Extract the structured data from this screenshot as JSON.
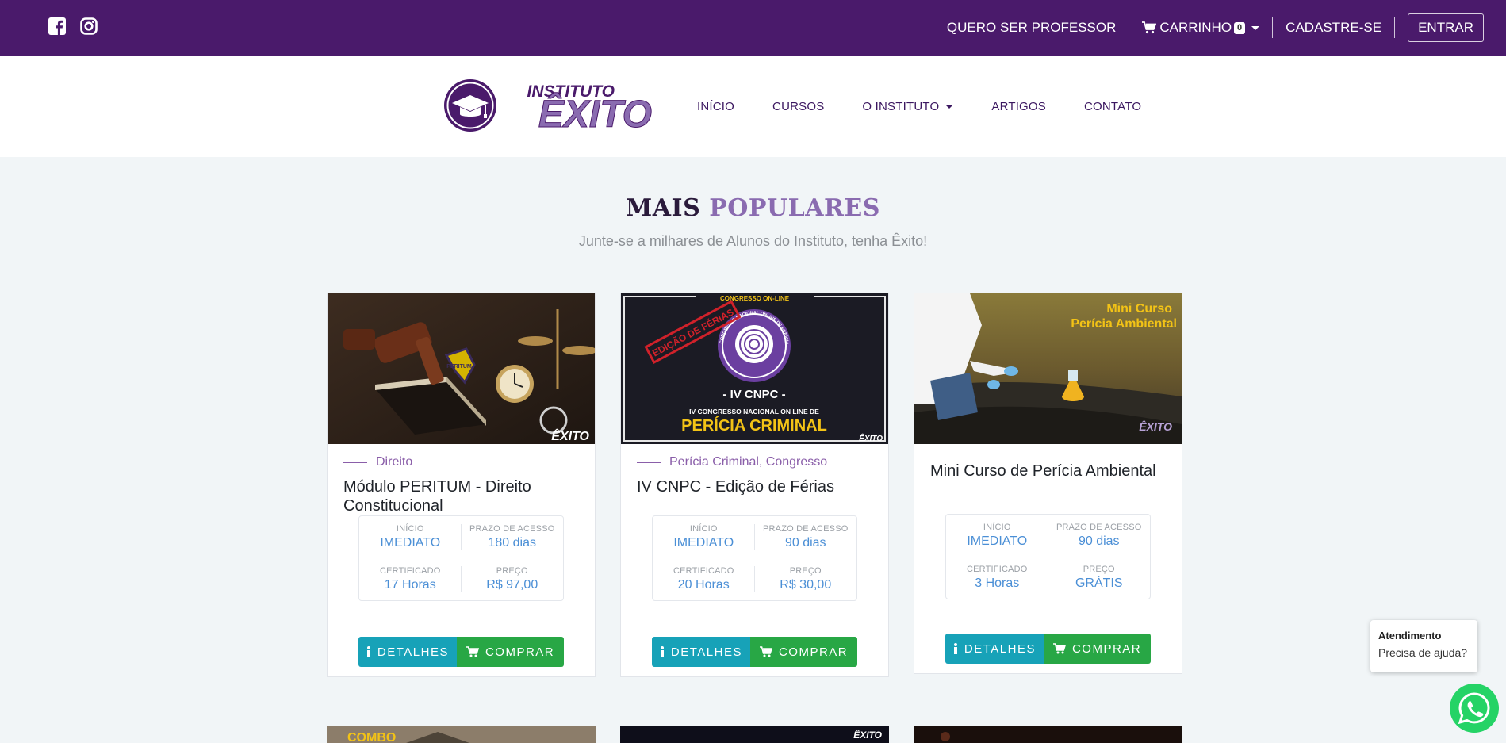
{
  "topbar": {
    "social": [
      {
        "icon": "facebook-icon"
      },
      {
        "icon": "instagram-icon"
      }
    ],
    "links": {
      "teacher": "QUERO SER PROFESSOR",
      "cart": "CARRINHO",
      "cart_count": "0",
      "signup": "CADASTRE-SE",
      "login": "ENTRAR"
    }
  },
  "header": {
    "logo_text_top": "INSTITUTO",
    "logo_text_main": "ÊXITO",
    "nav": [
      {
        "label": "INÍCIO"
      },
      {
        "label": "CURSOS"
      },
      {
        "label": "O INSTITUTO"
      },
      {
        "label": "ARTIGOS"
      },
      {
        "label": "CONTATO"
      }
    ]
  },
  "section": {
    "title_a": "MAIS",
    "title_b": "POPULARES",
    "subtitle": "Junte-se a milhares de Alunos do Instituto, tenha Êxito!"
  },
  "labels": {
    "start": "INÍCIO",
    "access": "PRAZO DE ACESSO",
    "certificate": "CERTIFICADO",
    "price": "PREÇO",
    "details": "DETALHES",
    "buy": "COMPRAR"
  },
  "courses": [
    {
      "category": "Direito",
      "title": "Módulo PERITUM - Direito Constitucional",
      "start": "IMEDIATO",
      "access": "180 dias",
      "certificate": "17 Horas",
      "price": "R$ 97,00",
      "thumb": {
        "badge": "PERITUM",
        "brand": "ÊXITO"
      }
    },
    {
      "category": "Perícia Criminal, Congresso",
      "title": "IV CNPC - Edição de Férias",
      "start": "IMEDIATO",
      "access": "90 dias",
      "certificate": "20 Horas",
      "price": "R$ 30,00",
      "thumb": {
        "top": "CONGRESSO ON-LINE",
        "stamp": "EDIÇÃO DE FÉRIAS",
        "ring": "CONGRESSO NACIONAL ONLINE DE PERÍCIA CRIMINAL",
        "edition": "- IV CNPC -",
        "line1": "IV CONGRESSO NACIONAL ON LINE DE",
        "line2": "PERÍCIA CRIMINAL",
        "brand": "ÊXITO"
      }
    },
    {
      "category": "",
      "title": "Mini Curso de Perícia Ambiental",
      "start": "IMEDIATO",
      "access": "90 dias",
      "certificate": "3 Horas",
      "price": "GRÁTIS",
      "thumb": {
        "line1": "Mini Curso",
        "line2": "Perícia Ambiental",
        "brand": "ÊXITO"
      }
    }
  ],
  "peek": {
    "first": "COMBO",
    "second_brand": "ÊXITO"
  },
  "chat": {
    "title": "Atendimento",
    "message": "Precisa de ajuda?"
  }
}
